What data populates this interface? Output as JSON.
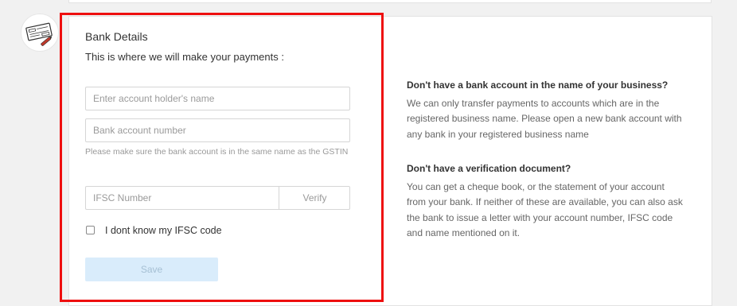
{
  "bank_details": {
    "title": "Bank Details",
    "subtitle": "This is where we will make your payments :",
    "account_holder_placeholder": "Enter account holder's name",
    "account_number_placeholder": "Bank account number",
    "hint": "Please make sure the bank account is in the same name as the GSTIN",
    "ifsc_placeholder": "IFSC Number",
    "verify_label": "Verify",
    "dont_know_ifsc_label": "I dont know my IFSC code",
    "dont_know_ifsc_checked": false,
    "save_label": "Save"
  },
  "faq": [
    {
      "question": "Don't have a bank account in the name of your business?",
      "answer": "We can only transfer payments to accounts which are in the registered business name. Please open a new bank account with any bank in your registered business name"
    },
    {
      "question": "Don't have a verification document?",
      "answer": "You can get a cheque book, or the statement of your account from your bank. If neither of these are available, you can also ask the bank to issue a letter with your account number, IFSC code and name mentioned on it."
    }
  ],
  "icons": {
    "section_icon": "cheque-icon"
  },
  "colors": {
    "highlight_border": "#ee0f0f",
    "save_button_bg": "#d9ecfb",
    "page_bg": "#f1f1f1"
  }
}
